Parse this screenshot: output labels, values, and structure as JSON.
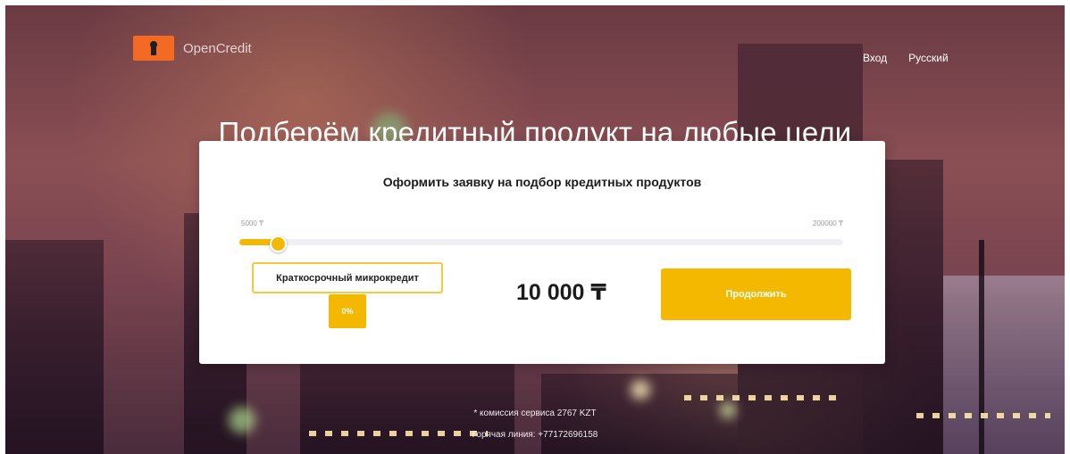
{
  "header": {
    "logo_text": "OpenCredit",
    "nav": [
      {
        "label": "Вход"
      },
      {
        "label": "Русский"
      }
    ]
  },
  "hero": {
    "headline": "Подберём кредитный продукт на любые цели"
  },
  "form": {
    "title": "Оформить заявку на подбор кредитных продуктов",
    "range_min_label": "5000 ₸",
    "range_max_label": "200000 ₸",
    "slider": {
      "min": 5000,
      "max": 200000,
      "value": 10000
    },
    "product_type": "Краткосрочный микрокредит",
    "rate": "0%",
    "amount_display": "10 000 ₸",
    "continue_label": "Продолжить"
  },
  "footer": {
    "commission": "* комиссия сервиса 2767 KZT",
    "hotline": "Горячая линия: +77172696158"
  },
  "colors": {
    "accent": "#f5b800",
    "logo": "#f26a24"
  },
  "icons": {
    "logo": "keyhole-logo-icon"
  }
}
